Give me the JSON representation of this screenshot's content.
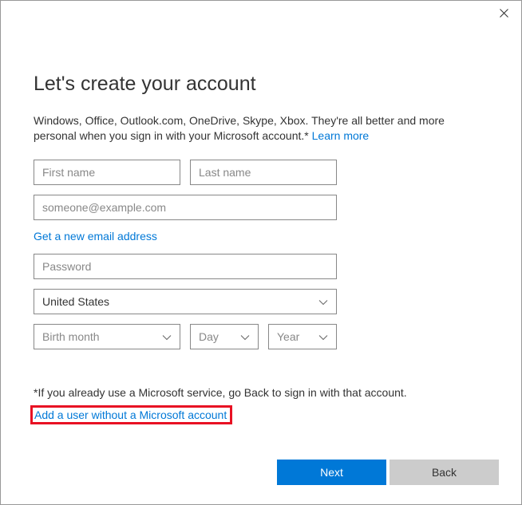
{
  "title": "Let's create your account",
  "description": "Windows, Office, Outlook.com, OneDrive, Skype, Xbox. They're all better and more personal when you sign in with your Microsoft account.* ",
  "learn_more": "Learn more",
  "fields": {
    "first_name_placeholder": "First name",
    "last_name_placeholder": "Last name",
    "email_placeholder": "someone@example.com",
    "password_placeholder": "Password",
    "country_value": "United States",
    "birth_month_placeholder": "Birth month",
    "day_placeholder": "Day",
    "year_placeholder": "Year"
  },
  "links": {
    "new_email": "Get a new email address",
    "add_user_no_ms": "Add a user without a Microsoft account"
  },
  "footnote": "*If you already use a Microsoft service, go Back to sign in with that account.",
  "buttons": {
    "next": "Next",
    "back": "Back"
  }
}
